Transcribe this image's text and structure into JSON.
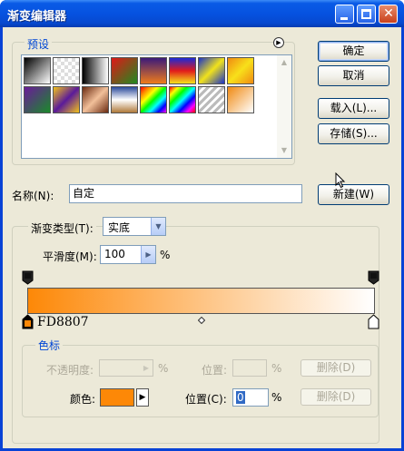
{
  "window": {
    "title": "渐变编辑器"
  },
  "presets": {
    "label": "预设",
    "swatches": [
      {
        "name": "black-white",
        "bg": "linear-gradient(135deg,#000 0%,#fff 100%)"
      },
      {
        "name": "transparent",
        "bg": "repeating-conic-gradient(#ddd 0 25%, #fff 0 50%) 0 0/8px 8px"
      },
      {
        "name": "black-white-2",
        "bg": "linear-gradient(90deg,#000,#fff)"
      },
      {
        "name": "red-green",
        "bg": "linear-gradient(135deg,#e01818,#1f8a1f)"
      },
      {
        "name": "violet-orange",
        "bg": "linear-gradient(180deg,#3b1a7a,#f07c1a)"
      },
      {
        "name": "blue-red-yellow",
        "bg": "linear-gradient(180deg,#1b2ad8,#e11b1b,#f5e21b)"
      },
      {
        "name": "blue-yellow-blue",
        "bg": "linear-gradient(135deg,#1a33c8,#f1e21b,#1a33c8)"
      },
      {
        "name": "orange-yellow",
        "bg": "linear-gradient(135deg,#f08a12,#f8e01a,#f08a12)"
      },
      {
        "name": "violet-green",
        "bg": "linear-gradient(135deg,#6a1a9a,#1a8a2a)"
      },
      {
        "name": "yellow-violet",
        "bg": "linear-gradient(135deg,#f2c21a,#5a1a9a,#f2c21a)"
      },
      {
        "name": "copper",
        "bg": "linear-gradient(135deg,#6a2a10,#f2c09a,#6a2a10)"
      },
      {
        "name": "chrome",
        "bg": "linear-gradient(180deg,#2a4a9a,#fff,#b07a3a)"
      },
      {
        "name": "spectrum",
        "bg": "linear-gradient(135deg,#f00,#f80,#ff0,#0f0,#0ff,#00f,#f0f)"
      },
      {
        "name": "transparent-rainbow",
        "bg": "linear-gradient(135deg,#f00,#ff0,#0f0,#0ff,#00f,#f0f,#f00)"
      },
      {
        "name": "transparent-stripes",
        "bg": "repeating-linear-gradient(135deg,#bbb 0 3px,#fff 3px 6px)"
      },
      {
        "name": "orange-white",
        "bg": "linear-gradient(135deg,#f08a12,#fff)"
      }
    ]
  },
  "buttons": {
    "ok": "确定",
    "cancel": "取消",
    "load": "载入(L)...",
    "save": "存储(S)...",
    "new": "新建(W)"
  },
  "name": {
    "label": "名称(N):",
    "value": "自定"
  },
  "gradient": {
    "type_label": "渐变类型(T):",
    "type_value": "实底",
    "smoothness_label": "平滑度(M):",
    "smoothness_value": "100",
    "percent": "%",
    "bar_start_color": "#FD8807",
    "bar_end_color": "#FFFFFF",
    "color_readout": "FD8807"
  },
  "stops": {
    "label": "色标",
    "opacity_label": "不透明度:",
    "opacity_percent": "%",
    "opacity_position_label": "位置:",
    "opacity_position_percent": "%",
    "delete_label": "删除(D)",
    "color_label": "颜色:",
    "color_swatch": "#FD8807",
    "color_position_label": "位置(C):",
    "color_position_value": "0",
    "color_position_percent": "%",
    "color_delete_label": "删除(D)"
  }
}
